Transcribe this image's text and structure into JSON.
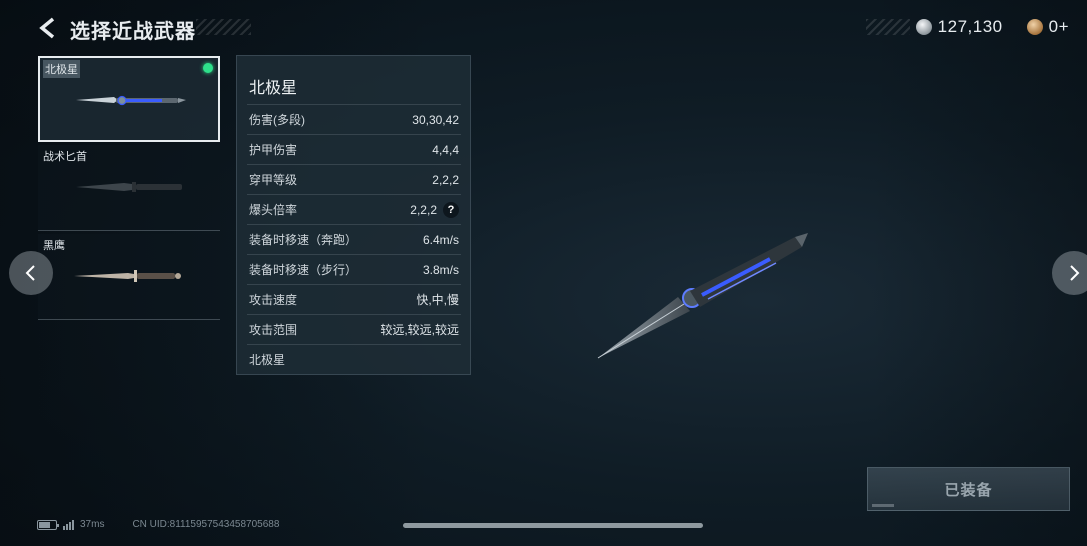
{
  "header": {
    "title": "选择近战武器"
  },
  "currency": [
    {
      "icon": "silver-coin-icon",
      "value": "127,130"
    },
    {
      "icon": "bronze-coin-icon",
      "value": "0+"
    }
  ],
  "weapons": [
    {
      "name": "北极星",
      "selected": true,
      "equipped": true
    },
    {
      "name": "战术匕首",
      "selected": false,
      "equipped": false
    },
    {
      "name": "黑鹰",
      "selected": false,
      "equipped": false
    }
  ],
  "stats": {
    "title": "北极星",
    "rows": [
      {
        "label": "伤害(多段)",
        "value": "30,30,42"
      },
      {
        "label": "护甲伤害",
        "value": "4,4,4"
      },
      {
        "label": "穿甲等级",
        "value": "2,2,2"
      },
      {
        "label": "爆头倍率",
        "value": "2,2,2",
        "help": "?"
      },
      {
        "label": "装备时移速（奔跑）",
        "value": "6.4m/s"
      },
      {
        "label": "装备时移速（步行）",
        "value": "3.8m/s"
      },
      {
        "label": "攻击速度",
        "value": "快,中,慢"
      },
      {
        "label": "攻击范围",
        "value": "较远,较远,较远"
      },
      {
        "label": "北极星",
        "value": ""
      }
    ]
  },
  "equip_button": {
    "label": "已装备"
  },
  "footer": {
    "ping": "37ms",
    "uid": "CN UID:81115957543458705688"
  },
  "colors": {
    "equipped_dot": "#2ee08a",
    "blade_accent": "#3a5cff"
  }
}
